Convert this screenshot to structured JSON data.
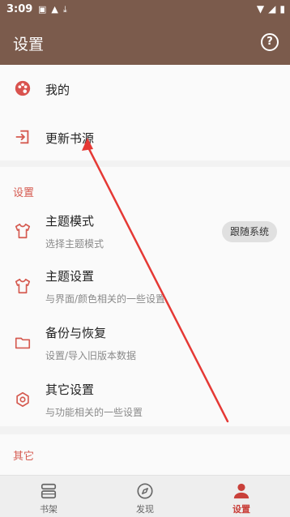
{
  "status_bar": {
    "time": "3:09"
  },
  "app_bar": {
    "title": "设置",
    "help_glyph": "?"
  },
  "account_items": [
    {
      "label": "我的",
      "icon": "palette-icon"
    },
    {
      "label": "更新书源",
      "icon": "import-icon"
    }
  ],
  "settings_section": {
    "title": "设置",
    "items": [
      {
        "label": "主题模式",
        "sub": "选择主题模式",
        "icon": "tshirt-icon",
        "value": "跟随系统"
      },
      {
        "label": "主题设置",
        "sub": "与界面/颜色相关的一些设置",
        "icon": "tshirt-icon"
      },
      {
        "label": "备份与恢复",
        "sub": "设置/导入旧版本数据",
        "icon": "folder-icon"
      },
      {
        "label": "其它设置",
        "sub": "与功能相关的一些设置",
        "icon": "hexagon-gear-icon"
      }
    ]
  },
  "other_section": {
    "title": "其它"
  },
  "bottom_nav": [
    {
      "label": "书架",
      "icon": "bookshelf-icon",
      "active": false
    },
    {
      "label": "发现",
      "icon": "compass-icon",
      "active": false
    },
    {
      "label": "设置",
      "icon": "person-icon",
      "active": true
    }
  ],
  "colors": {
    "primary": "#7b5b4c",
    "accent": "#c9403a",
    "annotation_arrow": "#e53935"
  }
}
